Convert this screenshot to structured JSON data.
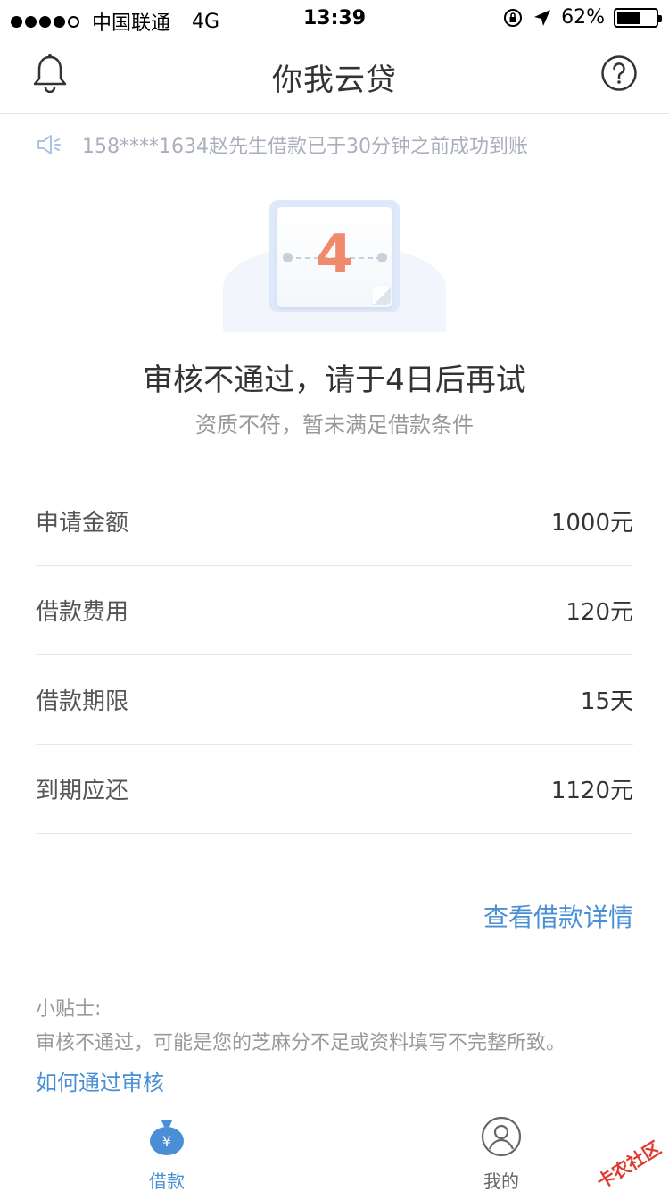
{
  "status_bar": {
    "carrier": "中国联通",
    "network": "4G",
    "time": "13:39",
    "battery": "62%",
    "battery_level": 0.62
  },
  "nav": {
    "title": "你我云贷",
    "left_icon": "bell-icon",
    "right_icon": "help-icon"
  },
  "notice": {
    "icon": "speaker-icon",
    "text": "158****1634赵先生借款已于30分钟之前成功到账"
  },
  "illustration": {
    "number": "4"
  },
  "result": {
    "title": "审核不通过，请于4日后再试",
    "subtitle": "资质不符，暂未满足借款条件"
  },
  "details": [
    {
      "label": "申请金额",
      "value": "1000元"
    },
    {
      "label": "借款费用",
      "value": "120元"
    },
    {
      "label": "借款期限",
      "value": "15天"
    },
    {
      "label": "到期应还",
      "value": "1120元"
    }
  ],
  "detail_link": "查看借款详情",
  "tips": {
    "title": "小贴士:",
    "body": "审核不通过，可能是您的芝麻分不足或资料填写不完整所致。",
    "link": "如何通过审核"
  },
  "tabs": [
    {
      "label": "借款",
      "icon": "money-bag-icon",
      "active": true
    },
    {
      "label": "我的",
      "icon": "user-icon",
      "active": false
    }
  ],
  "watermark": "卡农社区",
  "colors": {
    "accent": "#4a8fd6",
    "number": "#f08a6c",
    "muted": "#999999"
  }
}
